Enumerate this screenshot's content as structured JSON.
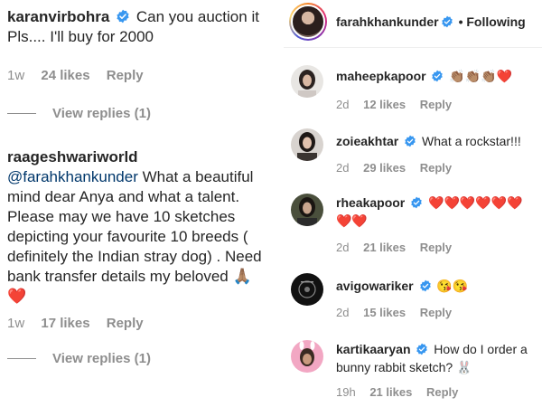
{
  "left": {
    "comment1": {
      "username": "karanvirbohra",
      "text": "Can you auction it Pls.... I'll buy for 2000",
      "time": "1w",
      "likes": "24 likes",
      "reply": "Reply",
      "view_replies": "View replies (1)"
    },
    "comment2": {
      "username": "raageshwariworld",
      "mention": "@farahkhankunder",
      "text": "What a beautiful mind dear Anya and what a talent. Please may we have 10 sketches depicting your favourite 10 breeds ( definitely the Indian stray dog) . Need bank transfer details my beloved",
      "emoji": "🙏🏽 ❤️",
      "time": "1w",
      "likes": "17 likes",
      "reply": "Reply",
      "view_replies": "View replies (1)"
    }
  },
  "right": {
    "header": {
      "username": "farahkhankunder",
      "following": "• Following"
    },
    "comments": [
      {
        "username": "maheepkapoor",
        "text": "👏🏽👏🏽👏🏽❤️",
        "time": "2d",
        "likes": "12 likes",
        "reply": "Reply"
      },
      {
        "username": "zoieakhtar",
        "text": "What a rockstar!!!",
        "time": "2d",
        "likes": "29 likes",
        "reply": "Reply"
      },
      {
        "username": "rheakapoor",
        "text": "❤️❤️❤️❤️❤️❤️❤️❤️",
        "time": "2d",
        "likes": "21 likes",
        "reply": "Reply"
      },
      {
        "username": "avigowariker",
        "text": "😘😘",
        "time": "2d",
        "likes": "15 likes",
        "reply": "Reply"
      },
      {
        "username": "kartikaaryan",
        "text": "How do I order a bunny rabbit sketch? 🐰",
        "time": "19h",
        "likes": "21 likes",
        "reply": "Reply"
      }
    ]
  },
  "colors": {
    "verified": "#3897f0",
    "meta_gray": "#8e8e8e",
    "mention": "#00376b",
    "heart": "#ed1c24"
  }
}
